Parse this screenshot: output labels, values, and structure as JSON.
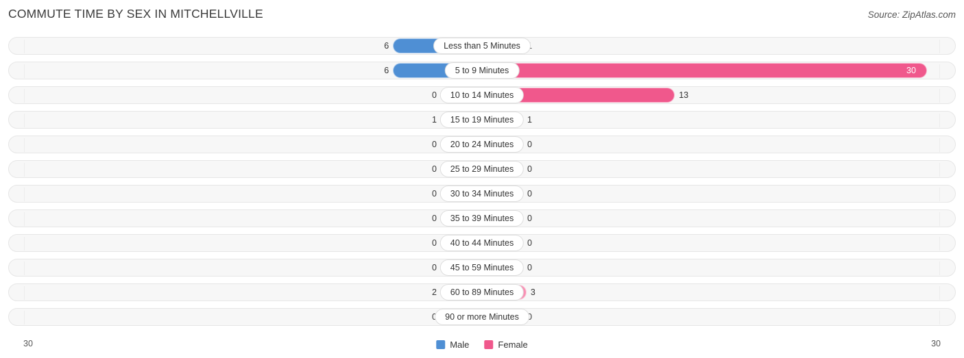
{
  "header": {
    "title": "COMMUTE TIME BY SEX IN MITCHELLVILLE",
    "source": "Source: ZipAtlas.com"
  },
  "axis": {
    "left_label": "30",
    "right_label": "30"
  },
  "legend": {
    "items": [
      {
        "label": "Male",
        "color": "#4f8fd4"
      },
      {
        "label": "Female",
        "color": "#f0588c"
      }
    ]
  },
  "chart_data": {
    "type": "bar",
    "subtype": "diverging-bidirectional",
    "title": "COMMUTE TIME BY SEX IN MITCHELLVILLE",
    "xlabel": "",
    "ylabel": "",
    "xlim": [
      30,
      30
    ],
    "grid": false,
    "legend_position": "bottom-center",
    "categories": [
      "Less than 5 Minutes",
      "5 to 9 Minutes",
      "10 to 14 Minutes",
      "15 to 19 Minutes",
      "20 to 24 Minutes",
      "25 to 29 Minutes",
      "30 to 34 Minutes",
      "35 to 39 Minutes",
      "40 to 44 Minutes",
      "45 to 59 Minutes",
      "60 to 89 Minutes",
      "90 or more Minutes"
    ],
    "series": [
      {
        "name": "Male",
        "color": "#4f8fd4",
        "direction": "left",
        "values": [
          6,
          6,
          0,
          1,
          0,
          0,
          0,
          0,
          0,
          0,
          2,
          0
        ]
      },
      {
        "name": "Female",
        "color": "#f0588c",
        "direction": "right",
        "values": [
          1,
          30,
          13,
          1,
          0,
          0,
          0,
          0,
          0,
          0,
          3,
          0
        ]
      }
    ]
  },
  "rows": [
    {
      "label": "Less than 5 Minutes",
      "male": "6",
      "female": "1"
    },
    {
      "label": "5 to 9 Minutes",
      "male": "6",
      "female": "30"
    },
    {
      "label": "10 to 14 Minutes",
      "male": "0",
      "female": "13"
    },
    {
      "label": "15 to 19 Minutes",
      "male": "1",
      "female": "1"
    },
    {
      "label": "20 to 24 Minutes",
      "male": "0",
      "female": "0"
    },
    {
      "label": "25 to 29 Minutes",
      "male": "0",
      "female": "0"
    },
    {
      "label": "30 to 34 Minutes",
      "male": "0",
      "female": "0"
    },
    {
      "label": "35 to 39 Minutes",
      "male": "0",
      "female": "0"
    },
    {
      "label": "40 to 44 Minutes",
      "male": "0",
      "female": "0"
    },
    {
      "label": "45 to 59 Minutes",
      "male": "0",
      "female": "0"
    },
    {
      "label": "60 to 89 Minutes",
      "male": "2",
      "female": "3"
    },
    {
      "label": "90 or more Minutes",
      "male": "0",
      "female": "0"
    }
  ]
}
